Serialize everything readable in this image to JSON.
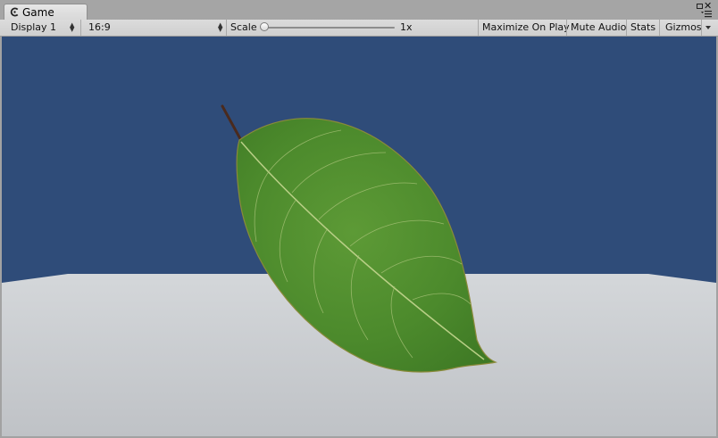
{
  "window": {
    "tab_title": "Game",
    "tab_icon": "unity-game-icon"
  },
  "toolbar": {
    "display": "Display 1",
    "aspect": "16:9",
    "scale_label": "Scale",
    "scale_value": "1x",
    "scale_level": 0.0,
    "maximize_on_play": "Maximize On Play",
    "mute_audio": "Mute Audio",
    "stats": "Stats",
    "gizmos": "Gizmos"
  },
  "scene": {
    "sky_color": "#2f4c79",
    "floor_color": "#c8cbcf",
    "leaf_color": "#4e8a2f",
    "object": "leaf"
  }
}
